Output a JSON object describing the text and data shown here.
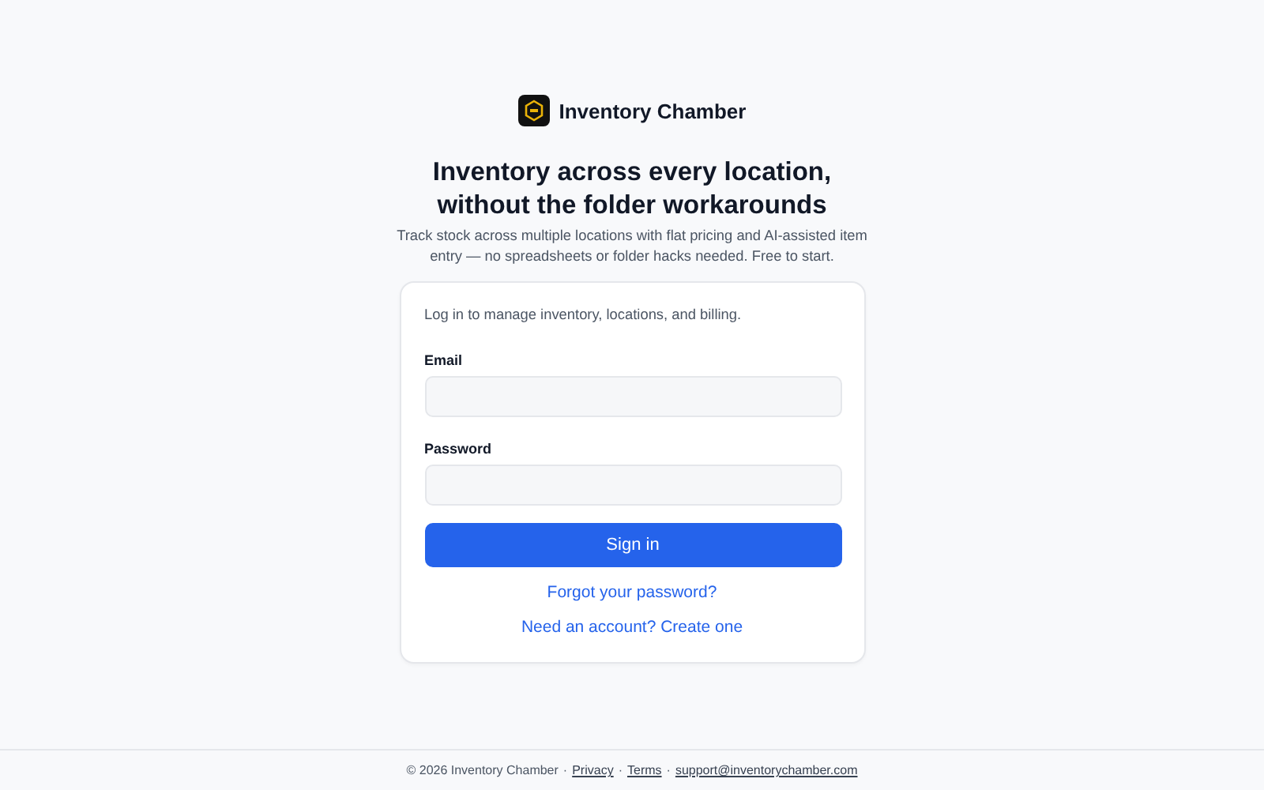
{
  "brand": {
    "name": "Inventory Chamber"
  },
  "headline": "Inventory across every location, without the folder workarounds",
  "subheadline": "Track stock across multiple locations with flat pricing and AI-assisted item entry — no spreadsheets or folder hacks needed. Free to start.",
  "card": {
    "intro": "Log in to manage inventory, locations, and billing.",
    "fields": [
      {
        "label": "Email"
      },
      {
        "label": "Password"
      }
    ],
    "submit": "Sign in",
    "links": [
      "Forgot your password?",
      "Need an account? Create one"
    ]
  },
  "footer": [
    {
      "kind": "text",
      "text": "© 2026 Inventory Chamber"
    },
    {
      "kind": "sep",
      "text": "·"
    },
    {
      "kind": "link",
      "text": "Privacy"
    },
    {
      "kind": "sep",
      "text": "·"
    },
    {
      "kind": "link",
      "text": "Terms"
    },
    {
      "kind": "sep",
      "text": "·"
    },
    {
      "kind": "link",
      "text": "support@inventorychamber.com"
    }
  ]
}
